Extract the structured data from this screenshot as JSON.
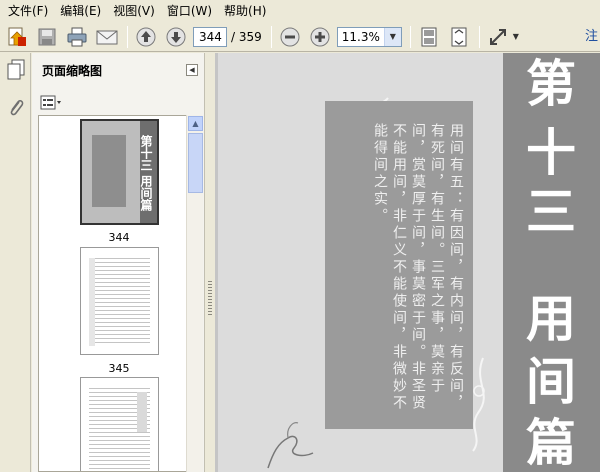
{
  "menu": [
    "文件(F)",
    "编辑(E)",
    "视图(V)",
    "窗口(W)",
    "帮助(H)"
  ],
  "toolbar": {
    "icons": [
      "create-pdf-icon",
      "save-icon",
      "print-icon",
      "email-icon",
      "previous-page-icon",
      "next-page-icon",
      "zoom-out-icon",
      "zoom-in-icon",
      "single-page-icon",
      "fit-page-icon",
      "full-screen-icon"
    ],
    "current_page": "344",
    "total_pages": "/ 359",
    "zoom": "11.3%",
    "right_label": "注"
  },
  "panel": {
    "title": "页面缩略图",
    "thumbnails": [
      {
        "label": "344",
        "selected": true
      },
      {
        "label": "345",
        "selected": false
      },
      {
        "label": "",
        "selected": false
      }
    ]
  },
  "document": {
    "chapter_chars": [
      "第",
      "十",
      "三",
      "用",
      "间",
      "篇"
    ],
    "vertical_text": "用间有五：有因间，有内间，有反间，有死间，有生间。三军之事，莫亲于间，赏莫厚于间，事莫密于间。非圣贤不能用间，非仁义不能使间，非微妙不能得间之实。",
    "thumb_title": "第十三 用间篇",
    "colors": {
      "page_bg": "#dcdcdc",
      "band": "#8a8a8a",
      "text_box": "#9b9b9b",
      "accent_link": "#1f4fa0"
    }
  }
}
